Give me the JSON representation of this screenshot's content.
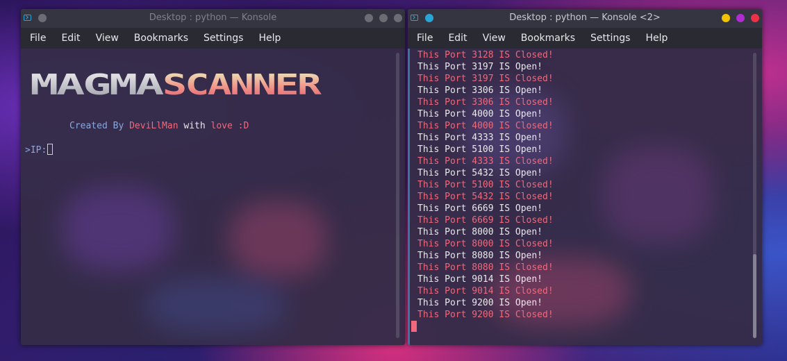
{
  "colors": {
    "open_text": "#e9e9ec",
    "closed_text": "#f0697c",
    "prompt": "#8aa9e0",
    "created_by": "#8aa9e0",
    "author": "#f0697c",
    "love": "#f0697c"
  },
  "left_window": {
    "title": "Desktop : python — Konsole",
    "menu": [
      "File",
      "Edit",
      "View",
      "Bookmarks",
      "Settings",
      "Help"
    ],
    "banner_left": "MAGMA",
    "banner_right": "SCANNER",
    "credit": {
      "created_by": "Created By ",
      "author": "DeviLlMan",
      "with": " with ",
      "love": "love :D"
    },
    "prompt": ">IP:"
  },
  "right_window": {
    "title": "Desktop : python — Konsole <2>",
    "menu": [
      "File",
      "Edit",
      "View",
      "Bookmarks",
      "Settings",
      "Help"
    ],
    "lines": [
      {
        "text": "This Port 3128 IS Closed!",
        "status": "closed"
      },
      {
        "text": "This Port 3197 IS Open!",
        "status": "open"
      },
      {
        "text": "This Port 3197 IS Closed!",
        "status": "closed"
      },
      {
        "text": "This Port 3306 IS Open!",
        "status": "open"
      },
      {
        "text": "This Port 3306 IS Closed!",
        "status": "closed"
      },
      {
        "text": "This Port 4000 IS Open!",
        "status": "open"
      },
      {
        "text": "This Port 4000 IS Closed!",
        "status": "closed"
      },
      {
        "text": "This Port 4333 IS Open!",
        "status": "open"
      },
      {
        "text": "This Port 5100 IS Open!",
        "status": "open"
      },
      {
        "text": "This Port 4333 IS Closed!",
        "status": "closed"
      },
      {
        "text": "This Port 5432 IS Open!",
        "status": "open"
      },
      {
        "text": "This Port 5100 IS Closed!",
        "status": "closed"
      },
      {
        "text": "This Port 5432 IS Closed!",
        "status": "closed"
      },
      {
        "text": "This Port 6669 IS Open!",
        "status": "open"
      },
      {
        "text": "This Port 6669 IS Closed!",
        "status": "closed"
      },
      {
        "text": "This Port 8000 IS Open!",
        "status": "open"
      },
      {
        "text": "This Port 8000 IS Closed!",
        "status": "closed"
      },
      {
        "text": "This Port 8080 IS Open!",
        "status": "open"
      },
      {
        "text": "This Port 8080 IS Closed!",
        "status": "closed"
      },
      {
        "text": "This Port 9014 IS Open!",
        "status": "open"
      },
      {
        "text": "This Port 9014 IS Closed!",
        "status": "closed"
      },
      {
        "text": "This Port 9200 IS Open!",
        "status": "open"
      },
      {
        "text": "This Port 9200 IS Closed!",
        "status": "closed"
      }
    ]
  }
}
